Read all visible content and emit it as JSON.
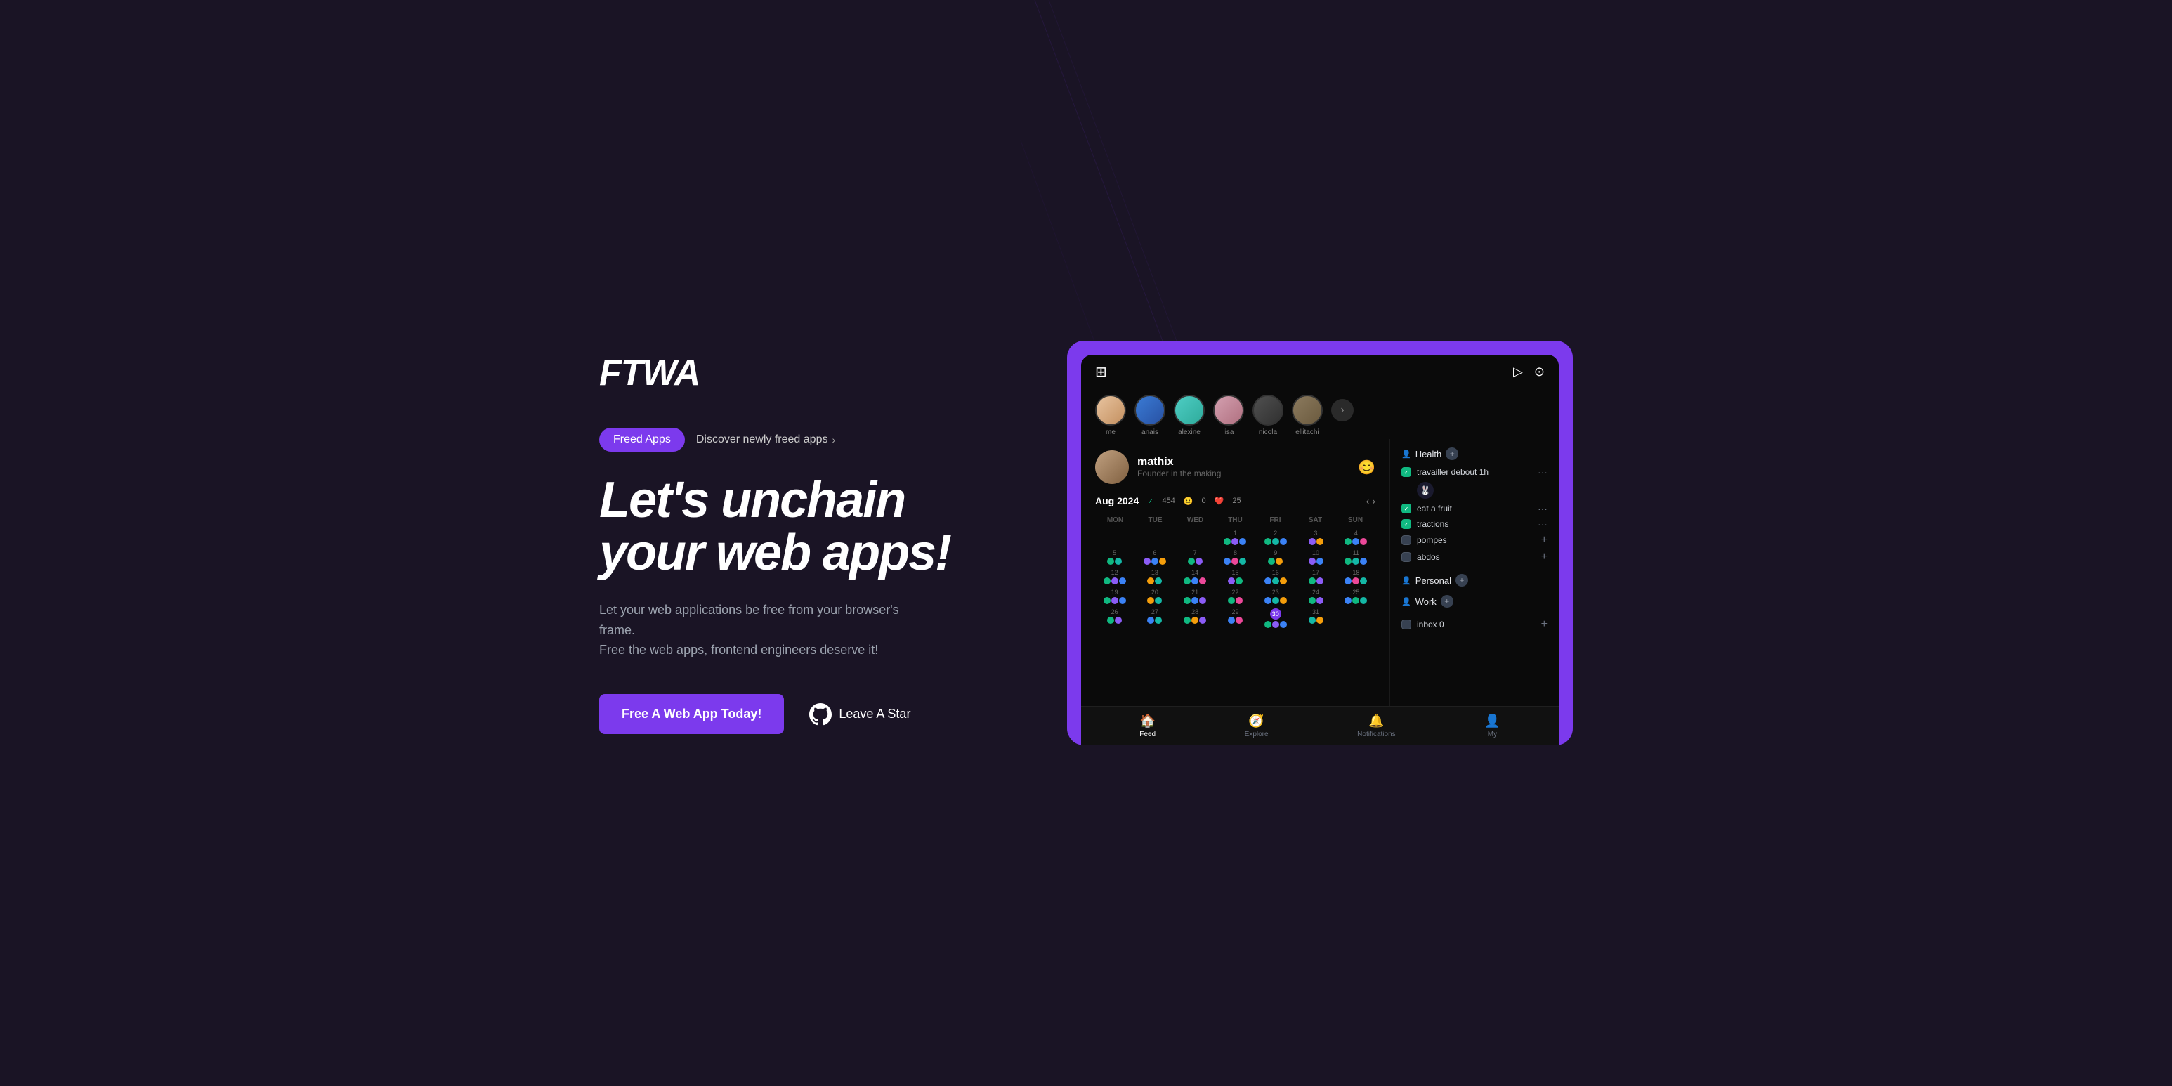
{
  "brand": {
    "logo": "FTWA"
  },
  "nav": {
    "freed_label": "Freed Apps",
    "discover_label": "Discover newly freed apps",
    "chevron": "›"
  },
  "hero": {
    "headline_line1": "Let's unchain",
    "headline_line2": "your web apps!",
    "subtext_line1": "Let your web applications be free from your browser's frame.",
    "subtext_line2": "Free the web apps, frontend engineers deserve it!",
    "cta_primary": "Free A Web App Today!",
    "cta_secondary": "Leave A Star"
  },
  "app_preview": {
    "users": [
      {
        "name": "me",
        "color1": "#e8c4a0",
        "color2": "#c49060"
      },
      {
        "name": "anais",
        "color1": "#3a7bd5",
        "color2": "#2851a3"
      },
      {
        "name": "alexine",
        "color1": "#4ecdc4",
        "color2": "#2eab9b"
      },
      {
        "name": "lisa",
        "color1": "#d4a0b0",
        "color2": "#b07080"
      },
      {
        "name": "nicola",
        "color1": "#505050",
        "color2": "#303030"
      },
      {
        "name": "ellitachi",
        "color1": "#8b7a5e",
        "color2": "#6b5a3e"
      }
    ],
    "profile": {
      "name": "mathix",
      "title": "Founder in the making"
    },
    "calendar": {
      "month": "Aug 2024",
      "stats": {
        "checkmark": "✓",
        "count1": "454",
        "emoji1": "😐",
        "count2": "0",
        "heart": "❤️",
        "count3": "25"
      },
      "days": [
        "MON",
        "TUE",
        "WED",
        "THU",
        "FRI",
        "SAT",
        "SUN"
      ]
    },
    "tasks": {
      "health_label": "Health",
      "items_health": [
        {
          "label": "travailler debout 1h",
          "checked": true
        },
        {
          "label": "eat a fruit",
          "checked": true
        },
        {
          "label": "tractions",
          "checked": true
        },
        {
          "label": "pompes",
          "checked": false
        },
        {
          "label": "abdos",
          "checked": false
        }
      ],
      "personal_label": "Personal",
      "work_label": "Work",
      "inbox_label": "inbox 0"
    },
    "bottom_nav": [
      {
        "icon": "🏠",
        "label": "Feed",
        "active": true
      },
      {
        "icon": "🧭",
        "label": "Explore",
        "active": false
      },
      {
        "icon": "🔔",
        "label": "Notifications",
        "active": false
      },
      {
        "icon": "👤",
        "label": "My",
        "active": false
      }
    ]
  },
  "colors": {
    "bg": "#1a1425",
    "accent": "#7c3aed",
    "app_bg": "#0a0a0a"
  }
}
